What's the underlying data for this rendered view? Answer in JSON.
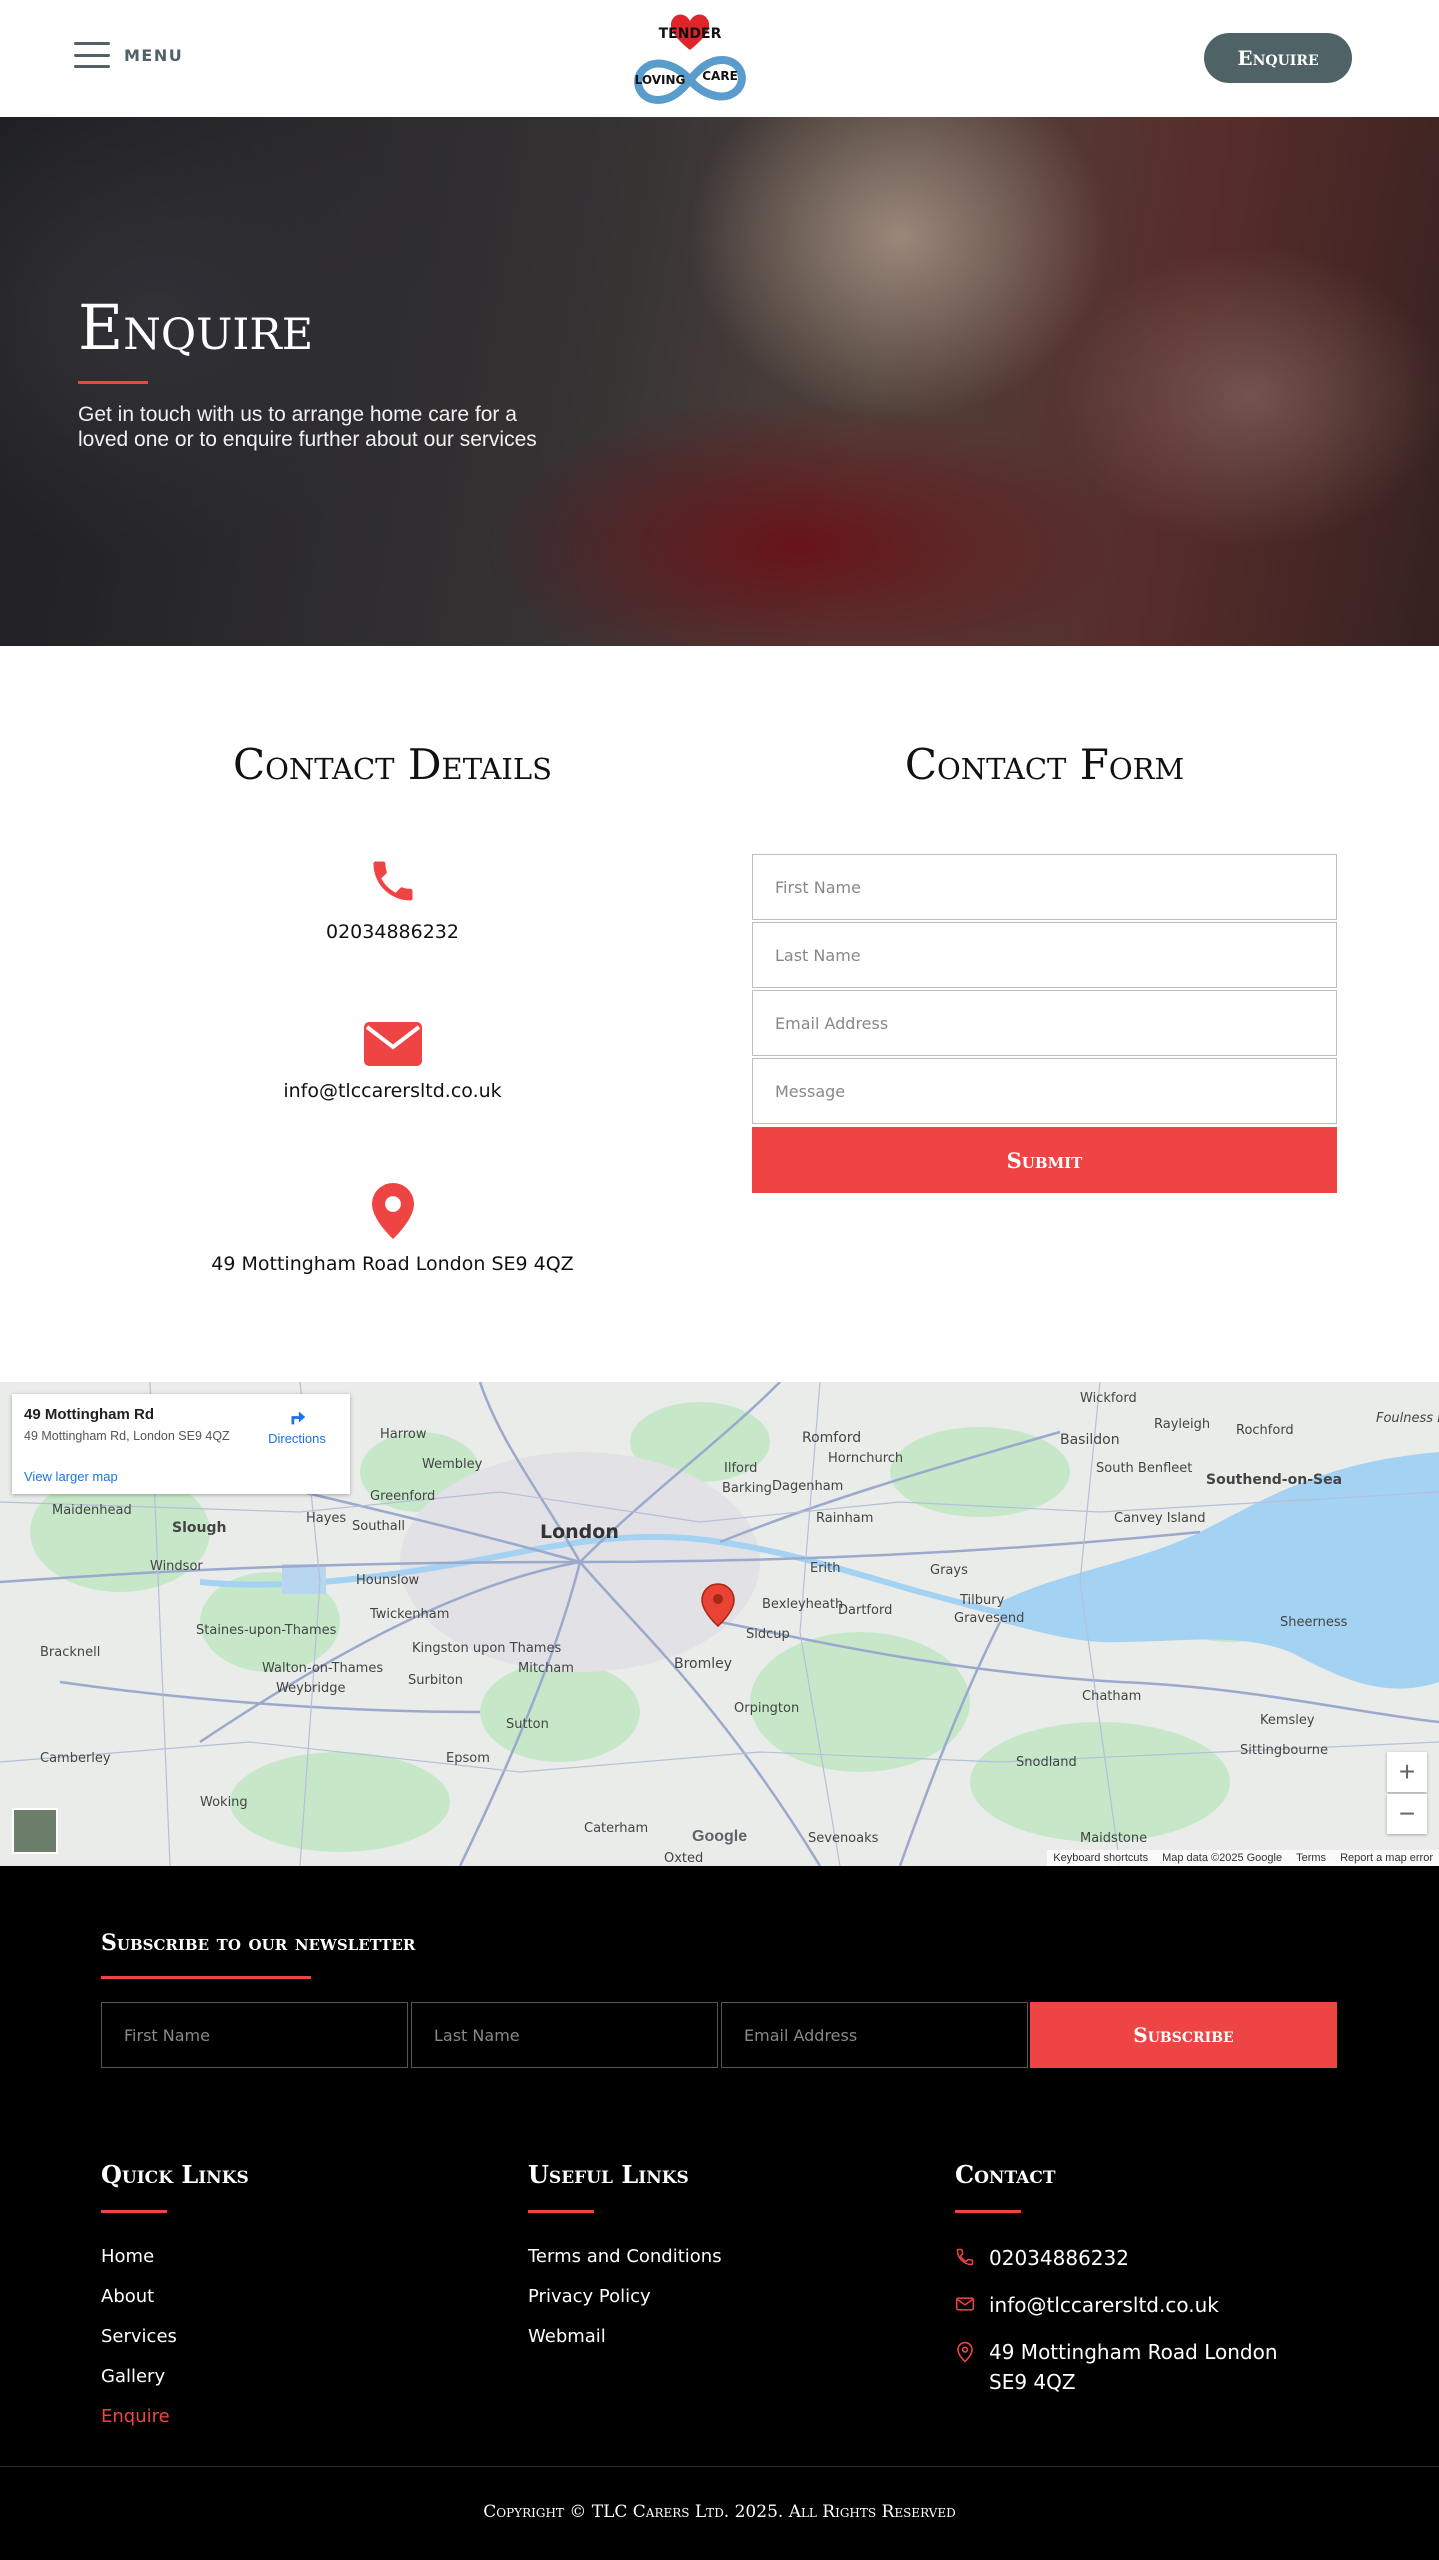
{
  "header": {
    "menu_label": "MENU",
    "logo": {
      "line1": "TENDER",
      "line2": "LOVING",
      "line3": "CARE"
    },
    "enquire_label": "Enquire"
  },
  "hero": {
    "title": "Enquire",
    "subtitle": "Get in touch with us to arrange home care for a loved one or to enquire further about our services"
  },
  "contact_details": {
    "title": "Contact Details",
    "phone": "02034886232",
    "email": "info@tlccarersltd.co.uk",
    "address": "49 Mottingham Road London SE9 4QZ"
  },
  "contact_form": {
    "title": "Contact Form",
    "first_name_placeholder": "First Name",
    "last_name_placeholder": "Last Name",
    "email_placeholder": "Email Address",
    "message_placeholder": "Message",
    "submit_label": "Submit"
  },
  "map": {
    "card_title": "49 Mottingham Rd",
    "card_address": "49 Mottingham Rd, London SE9 4QZ",
    "directions_label": "Directions",
    "larger_map_label": "View larger map",
    "zoom_in": "+",
    "zoom_out": "−",
    "google_label": "Google",
    "footer_items": [
      "Keyboard shortcuts",
      "Map data ©2025 Google",
      "Terms",
      "Report a map error"
    ],
    "places": {
      "london": "London",
      "slough": "Slough",
      "windsor": "Windsor",
      "maidenhead": "Maidenhead",
      "romford": "Romford",
      "hornchurch": "Hornchurch",
      "basildon": "Basildon",
      "southend": "Southend-on-Sea",
      "canvey": "Canvey Island",
      "dartford": "Dartford",
      "bexleyheath": "Bexleyheath",
      "sidcup": "Sidcup",
      "bromley": "Bromley",
      "orpington": "Orpington",
      "croydon": "Sutton",
      "kingston": "Kingston upon Thames",
      "twickenham": "Twickenham",
      "hounslow": "Hounslow",
      "woking": "Woking",
      "gravesend": "Gravesend",
      "chatham": "Chatham",
      "maidstone": "Maidstone",
      "sevenoaks": "Sevenoaks",
      "epsom": "Epsom",
      "rochford": "Rochford",
      "rayleigh": "Rayleigh",
      "wickford": "Wickford",
      "sheerness": "Sheerness",
      "tilbury": "Tilbury",
      "grays": "Grays",
      "ilford": "Ilford",
      "barking": "Barking",
      "dagenham": "Dagenham",
      "rainham": "Rainham",
      "harrow": "Harrow",
      "wembley": "Wembley",
      "greenford": "Greenford",
      "staines": "Staines-upon-Thames",
      "weybridge": "Weybridge",
      "mitcham": "Mitcham",
      "caterham": "Caterham",
      "oxted": "Oxted",
      "camberley": "Camberley",
      "bracknell": "Bracknell",
      "surbiton": "Surbiton",
      "hayes": "Hayes",
      "southall": "Southall",
      "walton": "Walton-on-Thames",
      "brentwood": "Erith",
      "southbenfleet": "South Benfleet",
      "foulness": "Foulness Island",
      "sittingbourne": "Sittingbourne",
      "snodland": "Snodland",
      "kemsley": "Kemsley"
    }
  },
  "newsletter": {
    "title": "Subscribe to our newsletter",
    "first_name_placeholder": "First Name",
    "last_name_placeholder": "Last Name",
    "email_placeholder": "Email Address",
    "subscribe_label": "Subscribe"
  },
  "footer": {
    "quick_links_title": "Quick Links",
    "quick_links": [
      "Home",
      "About",
      "Services",
      "Gallery",
      "Enquire"
    ],
    "useful_links_title": "Useful Links",
    "useful_links": [
      "Terms and Conditions",
      "Privacy Policy",
      "Webmail"
    ],
    "contact_title": "Contact",
    "phone": "02034886232",
    "email": "info@tlccarersltd.co.uk",
    "address": "49 Mottingham Road London SE9 4QZ",
    "copyright": "Copyright © TLC Carers Ltd. 2025. All Rights Reserved"
  },
  "colors": {
    "accent": "#ef4444",
    "slate": "#4f6266",
    "footer_bg": "#000000"
  }
}
